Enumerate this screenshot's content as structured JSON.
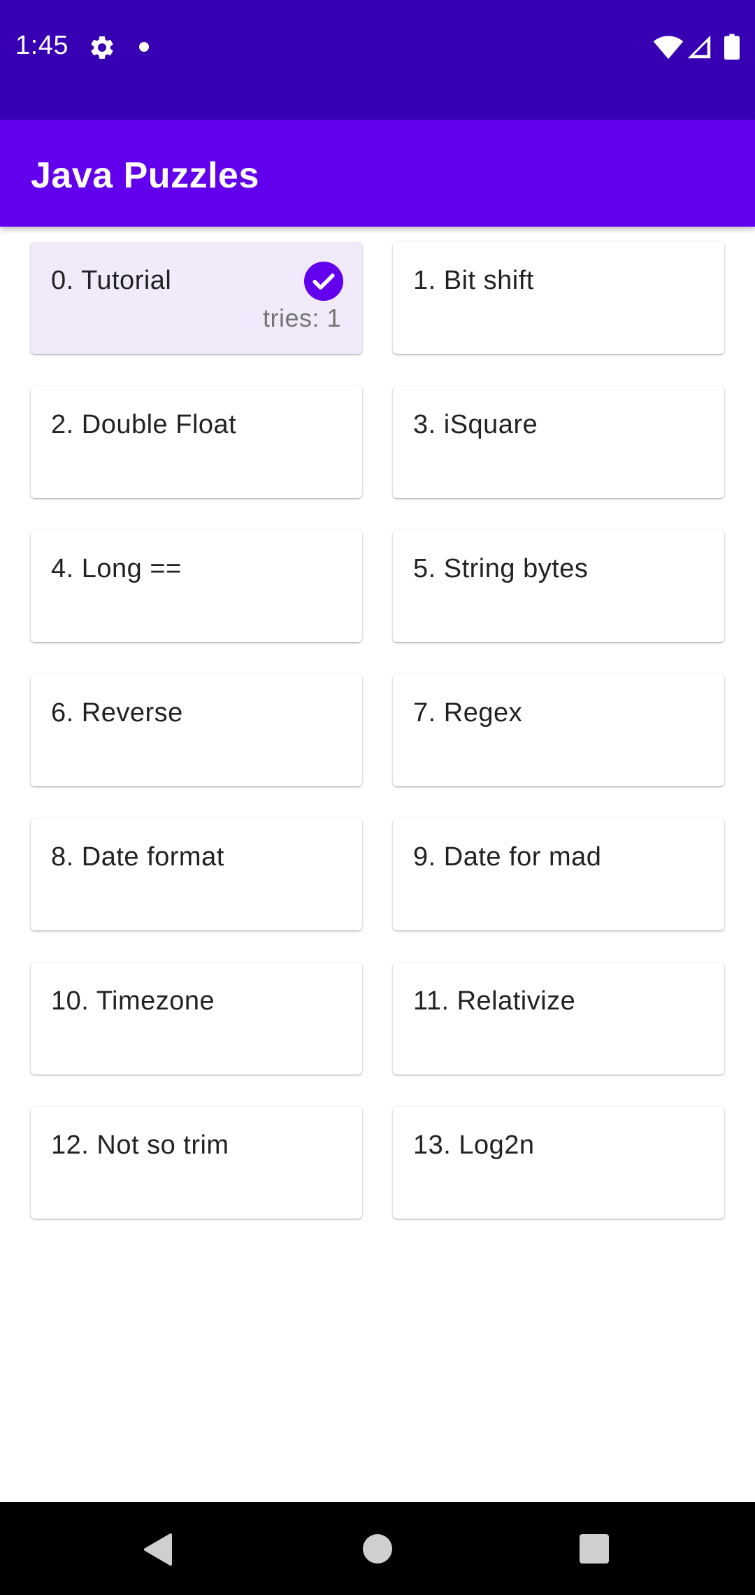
{
  "status_bar": {
    "time": "1:45",
    "icons": [
      "gear-icon",
      "notification-dot-icon",
      "wifi-icon",
      "cell-signal-icon",
      "battery-icon"
    ],
    "background": "#3700B3"
  },
  "app_bar": {
    "title": "Java Puzzles",
    "background": "#6200EE"
  },
  "puzzles": [
    {
      "label": "0. Tutorial",
      "solved": true,
      "tries": "tries: 1"
    },
    {
      "label": "1. Bit shift",
      "solved": false
    },
    {
      "label": "2. Double Float",
      "solved": false
    },
    {
      "label": "3. iSquare",
      "solved": false
    },
    {
      "label": "4. Long ==",
      "solved": false
    },
    {
      "label": "5. String bytes",
      "solved": false
    },
    {
      "label": "6. Reverse",
      "solved": false
    },
    {
      "label": "7. Regex",
      "solved": false
    },
    {
      "label": "8. Date format",
      "solved": false
    },
    {
      "label": "9. Date for mad",
      "solved": false
    },
    {
      "label": "10. Timezone",
      "solved": false
    },
    {
      "label": "11. Relativize",
      "solved": false
    },
    {
      "label": "12. Not so trim",
      "solved": false
    },
    {
      "label": "13. Log2n",
      "solved": false
    }
  ],
  "colors": {
    "accent": "#6200EE",
    "solved_card": "#F0EAFB"
  },
  "nav_bar": {
    "buttons": [
      "back-icon",
      "home-icon",
      "recents-icon"
    ]
  }
}
